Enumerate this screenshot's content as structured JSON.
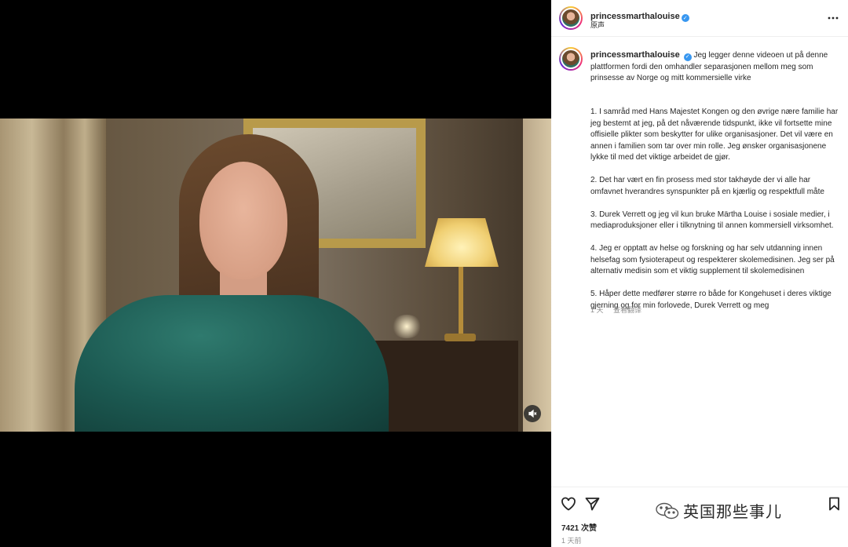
{
  "header": {
    "username": "princessmarthalouise",
    "subtitle": "原声"
  },
  "caption": {
    "username": "princessmarthalouise",
    "intro": "Jeg legger denne videoen ut på denne plattformen fordi den omhandler separasjonen mellom meg som prinsesse av Norge og mitt kommersielle virke",
    "points": [
      "1. I samråd med Hans Majestet Kongen og den øvrige nære familie har jeg bestemt at jeg, på det nåværende tidspunkt, ikke vil fortsette mine offisielle plikter som beskytter for ulike organisasjoner. Det vil være en annen i familien som tar over min rolle. Jeg ønsker organisasjonene lykke til med det viktige arbeidet de gjør.",
      "2. Det har vært en fin prosess med stor takhøyde der vi alle har omfavnet hverandres synspunkter på en kjærlig og respektfull måte",
      "3. Durek Verrett og jeg vil kun bruke Märtha Louise i sosiale medier, i mediaproduksjoner eller i tilknytning til annen kommersiell virksomhet.",
      "4. Jeg er opptatt av helse og forskning og har selv utdanning innen helsefag som fysioterapeut og respekterer skolemedisinen. Jeg ser på alternativ medisin som et viktig supplement til skolemedisinen",
      "5. Håper dette medfører større ro både for Kongehuset i deres viktige gjerning og for min forlovede, Durek Verrett og meg"
    ],
    "time": "1 天",
    "translation": "查看翻译"
  },
  "footer": {
    "likes": "7421 次赞",
    "posted": "1 天前",
    "watermark": "英国那些事儿"
  },
  "icons": {
    "more": "more-options-icon",
    "heart": "heart-icon",
    "share": "share-icon",
    "bookmark": "bookmark-icon",
    "mute": "muted-speaker-icon",
    "verified": "verified-badge-icon",
    "wechat": "wechat-logo-icon"
  },
  "colors": {
    "verified": "#3897f0",
    "muted_text": "#8e8e8e",
    "text": "#262626"
  }
}
